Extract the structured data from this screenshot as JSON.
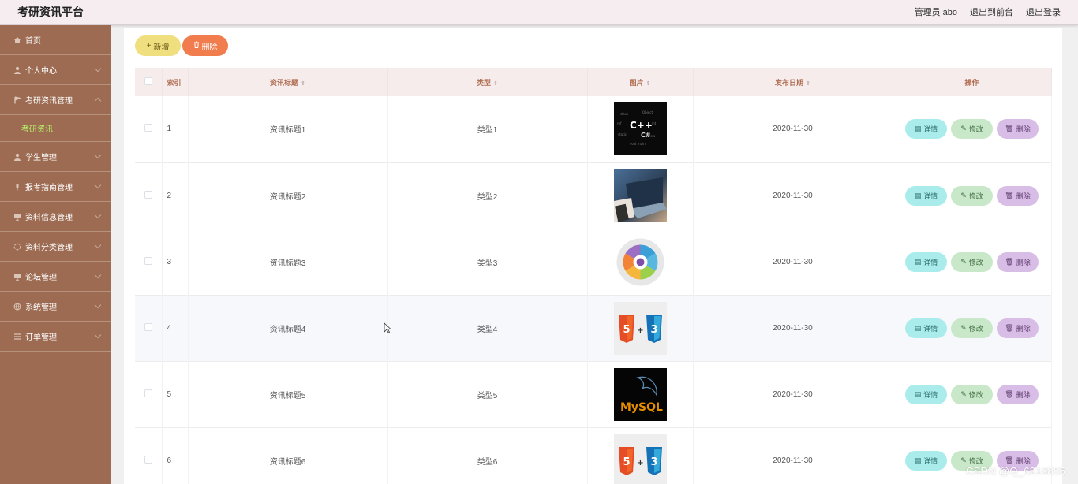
{
  "app": {
    "title": "考研资讯平台",
    "user_label": "管理员 abo",
    "to_front": "退出到前台",
    "logout": "退出登录"
  },
  "sidebar": {
    "items": [
      {
        "label": "首页",
        "icon": "home-icon"
      },
      {
        "label": "个人中心",
        "icon": "user-icon"
      },
      {
        "label": "考研资讯管理",
        "icon": "flag-icon",
        "sub": "考研资讯"
      },
      {
        "label": "学生管理",
        "icon": "user-icon"
      },
      {
        "label": "报考指南管理",
        "icon": "mic-icon"
      },
      {
        "label": "资料信息管理",
        "icon": "monitor-icon"
      },
      {
        "label": "资料分类管理",
        "icon": "loading-icon"
      },
      {
        "label": "论坛管理",
        "icon": "monitor-icon"
      },
      {
        "label": "系统管理",
        "icon": "globe-icon"
      },
      {
        "label": "订单管理",
        "icon": "list-icon"
      }
    ]
  },
  "toolbar": {
    "add_label": "新增",
    "delete_label": "删除"
  },
  "table": {
    "columns": [
      "索引",
      "资讯标题",
      "类型",
      "图片",
      "发布日期",
      "操作"
    ],
    "rows": [
      {
        "index": "1",
        "title": "资讯标题1",
        "type": "类型1",
        "image": "cpp-wordcloud-image",
        "date": "2020-11-30"
      },
      {
        "index": "2",
        "title": "资讯标题2",
        "type": "类型2",
        "image": "laptop-photo-image",
        "date": "2020-11-30"
      },
      {
        "index": "3",
        "title": "资讯标题3",
        "type": "类型3",
        "image": "circle-diagram-image",
        "date": "2020-11-30"
      },
      {
        "index": "4",
        "title": "资讯标题4",
        "type": "类型4",
        "image": "html5-css3-image",
        "date": "2020-11-30"
      },
      {
        "index": "5",
        "title": "资讯标题5",
        "type": "类型5",
        "image": "mysql-logo-image",
        "date": "2020-11-30"
      },
      {
        "index": "6",
        "title": "资讯标题6",
        "type": "类型6",
        "image": "html5-css3-image",
        "date": "2020-11-30"
      }
    ],
    "actions": {
      "detail": "详情",
      "edit": "修改",
      "delete": "删除"
    }
  },
  "thumb_text": {
    "cpp": "C++",
    "csharp": "C#",
    "html": "5",
    "css": "3",
    "plus": "+",
    "mysql": "MySQL"
  },
  "watermark": "CSDN @Q_6310855",
  "colors": {
    "sidebar": "#9c6b52",
    "header": "#f5edf0",
    "add": "#f0df7e",
    "delete": "#f17d4e",
    "detail": "#a9eceb",
    "edit": "#c9e8c9",
    "row_delete": "#d8bde6",
    "active_submenu": "#b9f26a"
  }
}
